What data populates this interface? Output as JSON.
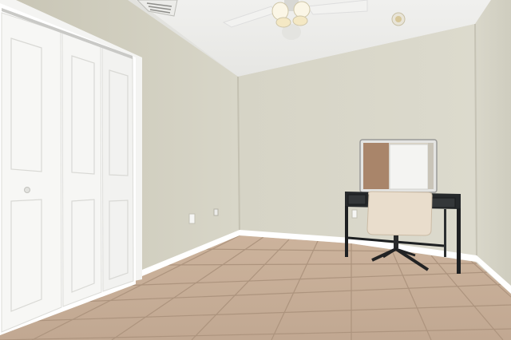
{
  "scene": {
    "subject": "empty-bedroom",
    "colors": {
      "wall_left": "#d2d0c2",
      "wall_back": "#d9d7ca",
      "ceiling": "#ebebe9",
      "floor": "#c6ad97",
      "grout": "#a98f79",
      "trim": "#ffffff",
      "closet_door": "#f7f7f5",
      "desk": "#26292b",
      "chair": "#e8dccb",
      "mirror_frame": "#dcdcdc"
    }
  }
}
